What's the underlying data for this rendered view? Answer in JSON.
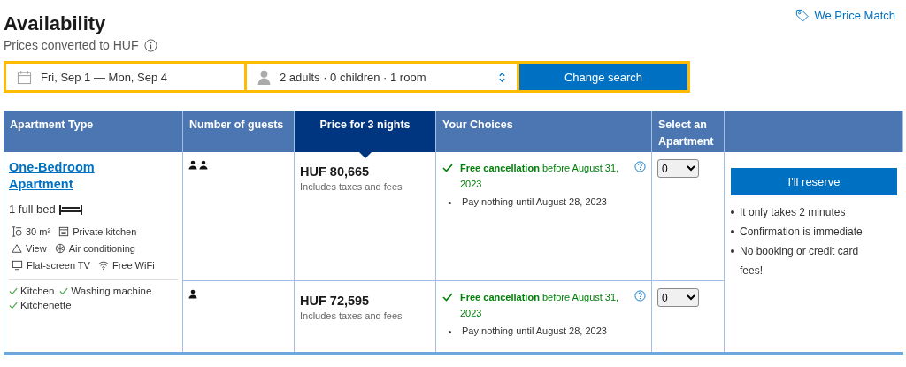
{
  "header": {
    "title": "Availability",
    "subtitle": "Prices converted to HUF",
    "price_match": "We Price Match"
  },
  "search": {
    "dates": "Fri, Sep 1 — Mon, Sep 4",
    "occupancy": "2 adults · 0 children · 1 room",
    "button": "Change search"
  },
  "table": {
    "columns": [
      {
        "label": "Apartment Type",
        "highlighted": false
      },
      {
        "label": "Number of guests",
        "highlighted": false
      },
      {
        "label": "Price for 3 nights",
        "highlighted": true
      },
      {
        "label": "Your Choices",
        "highlighted": false
      },
      {
        "label": "Select an Apartment",
        "highlighted": false
      }
    ],
    "room": {
      "name": "One-Bedroom Apartment",
      "bed": "1 full bed",
      "facilities": [
        {
          "kind": "size",
          "label": "30 m²"
        },
        {
          "kind": "kitchen",
          "label": "Private kitchen"
        },
        {
          "kind": "view",
          "label": "View"
        },
        {
          "kind": "ac",
          "label": "Air conditioning"
        },
        {
          "kind": "tv",
          "label": "Flat-screen TV"
        },
        {
          "kind": "wifi",
          "label": "Free WiFi"
        }
      ],
      "amenities": [
        "Kitchen",
        "Washing machine",
        "Kitchenette"
      ]
    },
    "options": [
      {
        "kind": "double",
        "price": "HUF 80,665",
        "price_note": "Includes taxes and fees",
        "cancellation": "**Free cancellation** before August 31, 2023",
        "payment": "Pay nothing until August 28, 2023",
        "quantity": "0"
      },
      {
        "kind": "single",
        "price": "HUF 72,595",
        "price_note": "Includes taxes and fees",
        "cancellation": "**Free cancellation** before August 31, 2023",
        "payment": "Pay nothing until August 28, 2023",
        "quantity": "0"
      }
    ],
    "reserve": {
      "button": "I'll reserve",
      "benefits": [
        "It only takes 2 minutes",
        "Confirmation is immediate",
        "No booking or credit card fees!"
      ]
    }
  }
}
